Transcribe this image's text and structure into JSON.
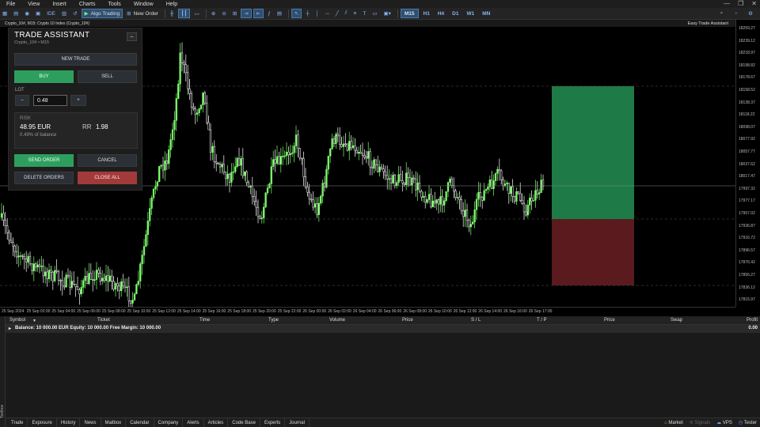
{
  "menu": [
    "File",
    "View",
    "Insert",
    "Charts",
    "Tools",
    "Window",
    "Help"
  ],
  "toolbar": {
    "algo_trading": "Algo Trading",
    "new_order": "New Order",
    "timeframes": [
      "M15",
      "H1",
      "H4",
      "D1",
      "W1",
      "MN"
    ],
    "active_timeframe": "M15"
  },
  "window_tabs": [
    "Crypto_10#, M15: Crypto 10 Index (Crypto_10#)"
  ],
  "chart": {
    "ea_label": "Easy Trade Assistant",
    "price_ticks": [
      "18259.27",
      "18239.12",
      "18218.97",
      "18198.82",
      "18178.67",
      "18158.52",
      "18138.37",
      "18118.22",
      "18098.07",
      "18077.92",
      "18057.77",
      "18037.62",
      "18017.47",
      "17997.32",
      "17977.17",
      "17957.02",
      "17936.87",
      "17916.72",
      "17896.57",
      "17876.42",
      "17856.27",
      "17836.12",
      "17815.97"
    ],
    "time_ticks": [
      "25 Sep 2024",
      "25 Sep 02:00",
      "25 Sep 04:00",
      "25 Sep 06:00",
      "25 Sep 08:00",
      "25 Sep 10:00",
      "25 Sep 12:00",
      "25 Sep 14:00",
      "25 Sep 16:00",
      "25 Sep 18:00",
      "25 Sep 20:00",
      "25 Sep 22:00",
      "26 Sep 00:00",
      "26 Sep 02:00",
      "26 Sep 04:00",
      "26 Sep 06:00",
      "26 Sep 08:00",
      "26 Sep 10:00",
      "26 Sep 12:00",
      "26 Sep 14:00",
      "26 Sep 16:00",
      "26 Sep 17:00"
    ],
    "colors": {
      "bull": "#7CFC6A",
      "bear": "#ffffff",
      "tp_zone": "#1e7a46",
      "sl_zone": "#5a1a1e"
    }
  },
  "panel": {
    "title": "TRADE ASSISTANT",
    "subtitle": "Crypto_10# • M15",
    "minimize": "–",
    "new_trade": "NEW TRADE",
    "buy": "BUY",
    "sell": "SELL",
    "lot_label": "LOT",
    "lot_minus": "–",
    "lot_value": "0.48",
    "lot_plus": "+",
    "risk_label": "RISK",
    "risk_amount": "48.95 EUR",
    "rr_label": "RR",
    "rr_value": "1.98",
    "risk_pct": "0.49% of balance",
    "send_order": "SEND ORDER",
    "cancel": "CANCEL",
    "delete_orders": "DELETE ORDERS",
    "close_all": "CLOSE ALL"
  },
  "trade_table": {
    "headers": [
      "Symbol",
      "Ticket",
      "Time",
      "Type",
      "Volume",
      "Price",
      "S / L",
      "T / P",
      "Price",
      "Swap",
      "Profit"
    ],
    "balance_line": "Balance: 10 000.00 EUR  Equity: 10 000.00  Free Margin: 10 000.00",
    "profit_total": "0.00"
  },
  "bottom_tabs": [
    "Trade",
    "Exposure",
    "History",
    "News",
    "Mailbox",
    "Calendar",
    "Company",
    "Alerts",
    "Articles",
    "Code Base",
    "Experts",
    "Journal"
  ],
  "active_bottom_tab": "Trade",
  "bottom_right": [
    "Market",
    "Signals",
    "VPS",
    "Tester"
  ],
  "toolbox_label": "Toolbox"
}
